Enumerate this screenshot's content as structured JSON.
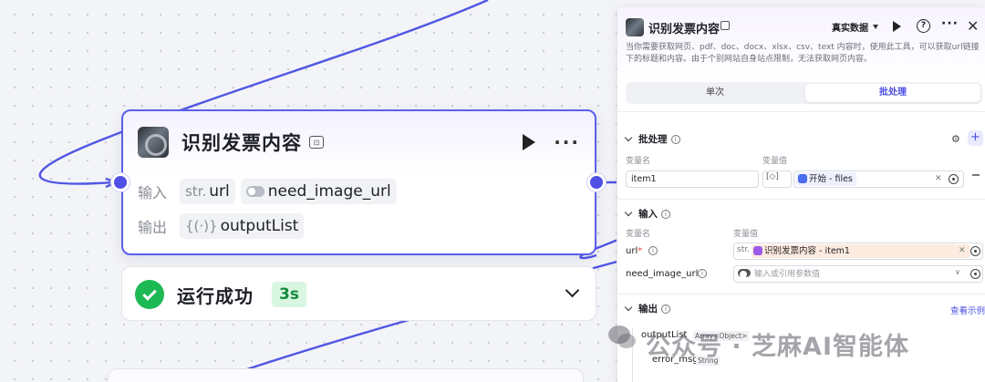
{
  "node": {
    "title": "识别发票内容",
    "input_label": "输入",
    "output_label": "输出",
    "inputs": [
      {
        "prefix": "str.",
        "name": "url"
      },
      {
        "name": "need_image_url"
      }
    ],
    "output": {
      "prefix": "{(·)}",
      "name": "outputList"
    }
  },
  "status": {
    "text": "运行成功",
    "duration": "3s"
  },
  "panel": {
    "title": "识别发票内容",
    "mode": "真实数据",
    "description": "当你需要获取网页、pdf、doc、docx、xlsx、csv、text 内容时，使用此工具，可以获取url链接下的标题和内容。由于个别网站自身站点限制，无法获取网页内容。",
    "tabs": [
      "单次",
      "批处理"
    ],
    "active_tab": "批处理",
    "batch": {
      "title": "批处理",
      "col_name": "变量名",
      "col_value": "变量值",
      "var_name": "item1",
      "ref_label": "开始 - files"
    },
    "input": {
      "title": "输入",
      "col_name": "变量名",
      "col_value": "变量值",
      "rows": [
        {
          "name": "url",
          "prefix": "str.",
          "ref": "识别发票内容 - item1"
        },
        {
          "name": "need_image_url",
          "placeholder": "输入或引用参数值"
        }
      ]
    },
    "output": {
      "title": "输出",
      "link": "查看示例",
      "items": [
        {
          "name": "outputList",
          "type": "Array<Object>"
        },
        {
          "name": "error_msg",
          "type": "String"
        }
      ]
    }
  },
  "watermark": "公众号 · 芝麻AI智能体",
  "colors": {
    "accent": "#4f4fe6",
    "success": "#1db954",
    "ref_orange_bg": "#fdebe0"
  }
}
